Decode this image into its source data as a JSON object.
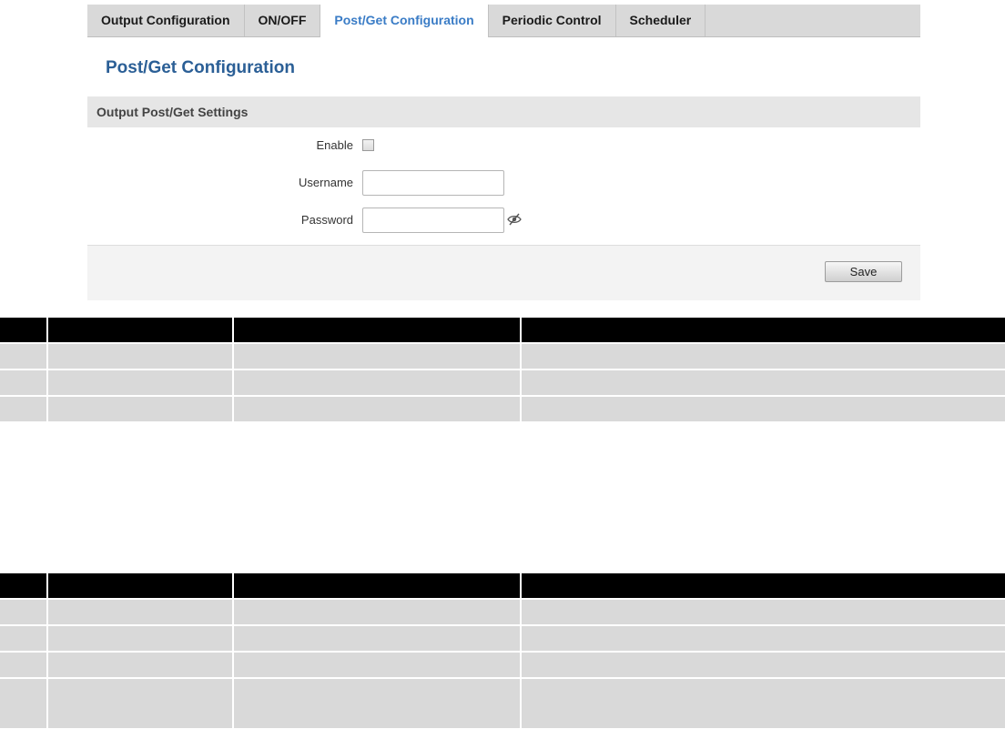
{
  "tabs": [
    {
      "label": "Output Configuration",
      "active": false
    },
    {
      "label": "ON/OFF",
      "active": false
    },
    {
      "label": "Post/Get Configuration",
      "active": true
    },
    {
      "label": "Periodic Control",
      "active": false
    },
    {
      "label": "Scheduler",
      "active": false
    }
  ],
  "page_title": "Post/Get Configuration",
  "section": {
    "title": "Output Post/Get Settings",
    "fields": {
      "enable": {
        "label": "Enable",
        "checked": false
      },
      "username": {
        "label": "Username",
        "value": ""
      },
      "password": {
        "label": "Password",
        "value": ""
      }
    }
  },
  "footer": {
    "save_label": "Save"
  },
  "colors": {
    "active_tab": "#3a7cc6",
    "title": "#2b5f96",
    "table_header": "#000000",
    "table_cell": "#d9d9d9"
  },
  "tables": [
    {
      "rows": 3
    },
    {
      "rows": 4
    }
  ]
}
